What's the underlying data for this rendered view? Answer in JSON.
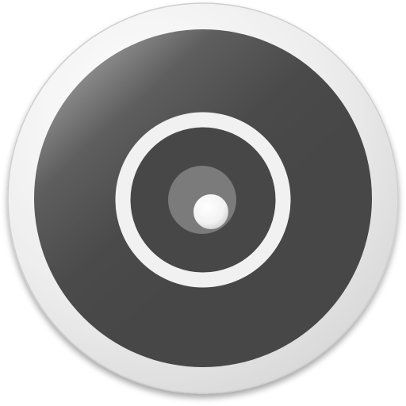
{
  "icon": {
    "name": "webcam-lens-icon",
    "colors": {
      "bezel_light": "#f4f4f4",
      "bezel_mid": "#e6e6e6",
      "bezel_shadow": "#b9b9b9",
      "face_highlight": "#9a9a9a",
      "face_dark": "#474747",
      "ring": "#f1f1f1",
      "lens_inner": "#474747",
      "iris": "#7b7b7c",
      "pupil_light": "#ffffff",
      "pupil_shade": "#cfcfcf",
      "background": "#ffffff"
    }
  }
}
